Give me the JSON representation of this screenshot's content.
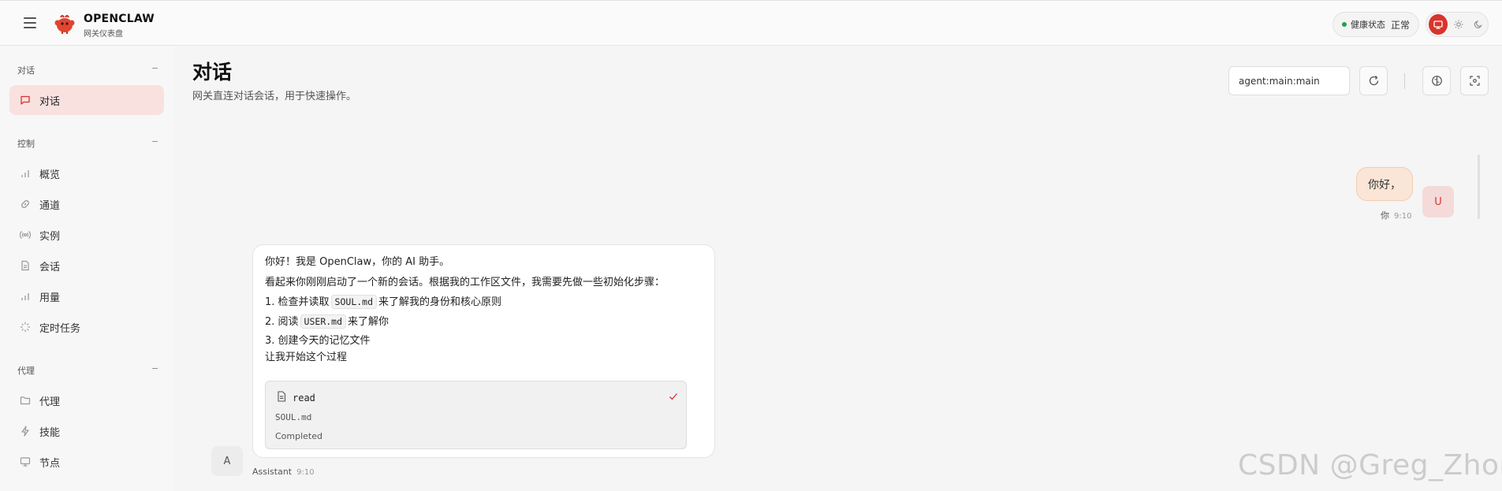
{
  "header": {
    "brand_name": "OPENCLAW",
    "brand_sub": "网关仪表盘",
    "health_label": "健康状态",
    "health_state": "正常",
    "theme_options": [
      "monitor-icon",
      "sun-icon",
      "moon-icon"
    ],
    "accent_color": "#d9342b"
  },
  "sidebar": {
    "sections": [
      {
        "title": "对话",
        "items": [
          {
            "label": "对话",
            "icon": "chat-icon",
            "active": true
          }
        ]
      },
      {
        "title": "控制",
        "items": [
          {
            "label": "概览",
            "icon": "bar-chart-icon"
          },
          {
            "label": "通道",
            "icon": "link-icon"
          },
          {
            "label": "实例",
            "icon": "radio-icon"
          },
          {
            "label": "会话",
            "icon": "document-icon"
          },
          {
            "label": "用量",
            "icon": "bar-chart-icon"
          },
          {
            "label": "定时任务",
            "icon": "loader-icon"
          }
        ]
      },
      {
        "title": "代理",
        "items": [
          {
            "label": "代理",
            "icon": "folder-icon"
          },
          {
            "label": "技能",
            "icon": "lightning-icon"
          },
          {
            "label": "节点",
            "icon": "monitor-icon"
          }
        ]
      }
    ],
    "collapse_glyph": "−"
  },
  "main": {
    "title": "对话",
    "subtitle": "网关直连对话会话，用于快速操作。",
    "session_key": "agent:main:main"
  },
  "chat": {
    "user": {
      "text": "你好，",
      "sender": "你",
      "time": "9:10",
      "avatar": "U"
    },
    "assistant": {
      "line1": "你好！我是 OpenClaw，你的 AI 助手。",
      "line2": "看起来你刚刚启动了一个新的会话。根据我的工作区文件，我需要先做一些初始化步骤：",
      "step1_pre": "1. 检查并读取",
      "step1_code": "SOUL.md",
      "step1_post": "来了解我的身份和核心原则",
      "step2_pre": "2. 阅读",
      "step2_code": "USER.md",
      "step2_post": "来了解你",
      "step3": "3. 创建今天的记忆文件",
      "line_last": "让我开始这个过程",
      "tool": {
        "name": "read",
        "arg": "SOUL.md",
        "status": "Completed"
      },
      "sender": "Assistant",
      "time": "9:10",
      "avatar": "A"
    }
  },
  "watermark": "CSDN @Greg_Zhong"
}
